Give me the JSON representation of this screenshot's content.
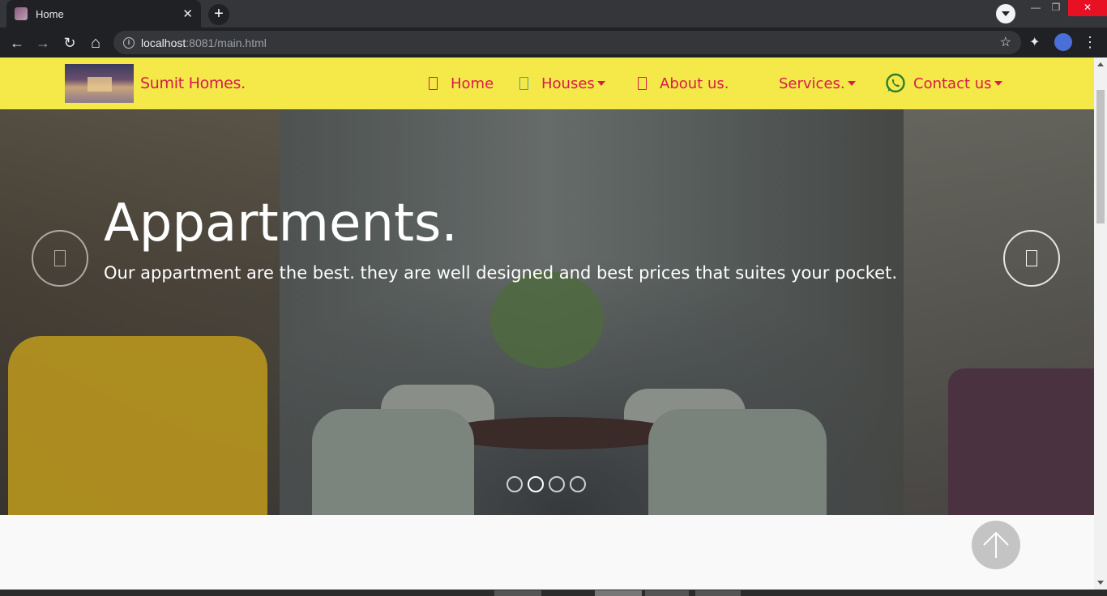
{
  "browser": {
    "tab_title": "Home",
    "tab_close": "✕",
    "new_tab": "+",
    "window_minimize": "—",
    "window_restore": "❐",
    "window_close": "✕",
    "back": "←",
    "forward": "→",
    "reload": "↻",
    "home": "⌂",
    "site_info": "i",
    "url_host": "localhost",
    "url_path": ":8081/main.html",
    "bookmark_star": "☆",
    "extensions": "✦",
    "menu": "⋮"
  },
  "navbar": {
    "brand": "Sumit Homes.",
    "items": [
      {
        "label": "Home",
        "icon": "page-icon",
        "has_caret": false
      },
      {
        "label": "Houses",
        "icon": "building-icon",
        "has_caret": true
      },
      {
        "label": "About us.",
        "icon": "info-icon",
        "has_caret": false
      },
      {
        "label": "Services.",
        "icon": "",
        "has_caret": true
      },
      {
        "label": "Contact us",
        "icon": "whatsapp-icon",
        "has_caret": true
      }
    ]
  },
  "hero": {
    "title": "Appartments.",
    "subtitle": "Our appartment are the best. they are well designed and best prices that suites your pocket.",
    "slide_count": 4,
    "active_slide": 2
  },
  "colors": {
    "navbar_bg": "#f5e94a",
    "brand_color": "#d81b4b",
    "whatsapp_green": "#2a7d2e"
  }
}
